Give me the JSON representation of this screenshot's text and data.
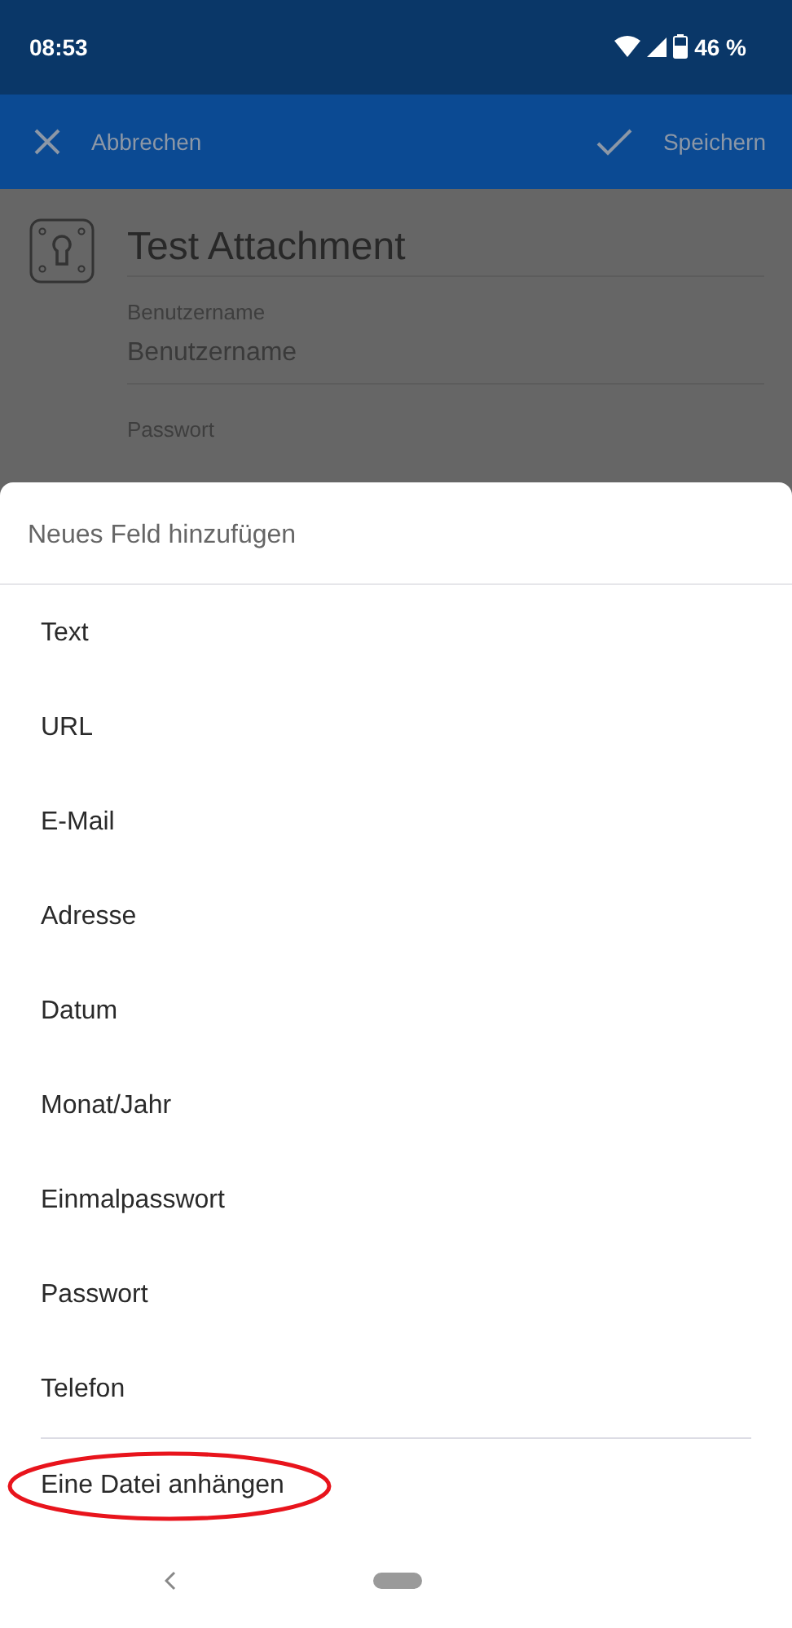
{
  "status_bar": {
    "time": "08:53",
    "battery": "46 %"
  },
  "toolbar": {
    "cancel": "Abbrechen",
    "save": "Speichern"
  },
  "form": {
    "title": "Test Attachment",
    "fields": [
      {
        "label": "Benutzername",
        "placeholder": "Benutzername"
      },
      {
        "label": "Passwort"
      }
    ]
  },
  "sheet": {
    "title": "Neues Feld hinzufügen",
    "items": [
      {
        "label": "Text"
      },
      {
        "label": "URL"
      },
      {
        "label": "E-Mail"
      },
      {
        "label": "Adresse"
      },
      {
        "label": "Datum"
      },
      {
        "label": "Monat/Jahr"
      },
      {
        "label": "Einmalpasswort"
      },
      {
        "label": "Passwort"
      },
      {
        "label": "Telefon"
      }
    ],
    "footer_item": {
      "label": "Eine Datei anhängen",
      "circled": true
    }
  }
}
